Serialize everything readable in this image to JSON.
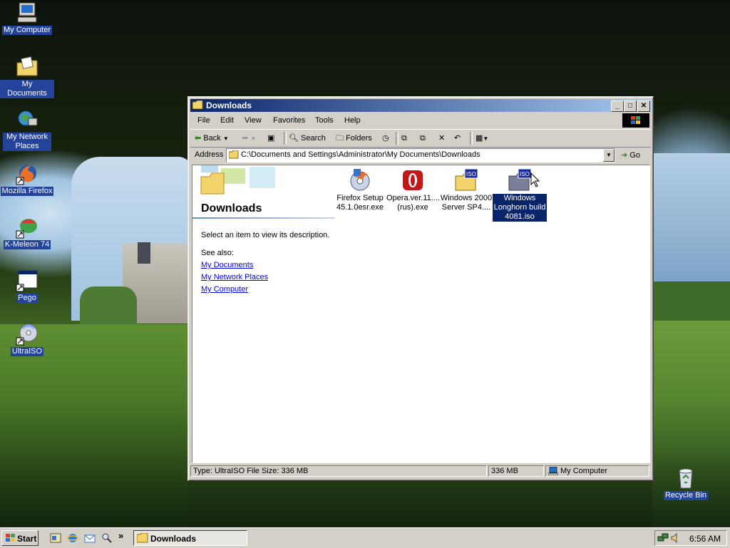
{
  "desktop": {
    "icons": [
      {
        "label": "My Computer",
        "icon": "my-computer-icon"
      },
      {
        "label": "My Documents",
        "icon": "my-documents-icon"
      },
      {
        "label": "My Network Places",
        "icon": "network-places-icon"
      },
      {
        "label": "Mozilla Firefox",
        "icon": "firefox-icon"
      },
      {
        "label": "K-Meleon 74",
        "icon": "k-meleon-icon"
      },
      {
        "label": "Pego",
        "icon": "pego-icon"
      },
      {
        "label": "UltraISO",
        "icon": "ultraiso-icon"
      },
      {
        "label": "Recycle Bin",
        "icon": "recycle-bin-icon"
      }
    ]
  },
  "window": {
    "title": "Downloads",
    "menu": [
      "File",
      "Edit",
      "View",
      "Favorites",
      "Tools",
      "Help"
    ],
    "toolbar": {
      "back": "Back",
      "search": "Search",
      "folders": "Folders"
    },
    "address": {
      "label": "Address",
      "value": "C:\\Documents and Settings\\Administrator\\My Documents\\Downloads",
      "go": "Go"
    },
    "panel": {
      "title": "Downloads",
      "description": "Select an item to view its description.",
      "see_also": "See also:",
      "links": [
        "My Documents",
        "My Network Places",
        "My Computer"
      ]
    },
    "files": [
      {
        "line1": "Firefox Setup",
        "line2": "45.1.0esr.exe",
        "line3": "",
        "icon": "firefox-setup-icon",
        "selected": false
      },
      {
        "line1": "Opera.ver.11....",
        "line2": "(rus).exe",
        "line3": "",
        "icon": "opera-icon",
        "selected": false
      },
      {
        "line1": "Windows 2000",
        "line2": "Server SP4....",
        "line3": "",
        "icon": "iso-file-icon",
        "selected": false
      },
      {
        "line1": "Windows",
        "line2": "Longhorn build",
        "line3": "4081.iso",
        "icon": "iso-file-icon",
        "selected": true
      }
    ],
    "status": {
      "info": "Type: UltraISO File Size: 336 MB",
      "size": "336 MB",
      "zone": "My Computer"
    }
  },
  "taskbar": {
    "start": "Start",
    "task": "Downloads",
    "chevron": "»",
    "clock": "6:56 AM"
  }
}
